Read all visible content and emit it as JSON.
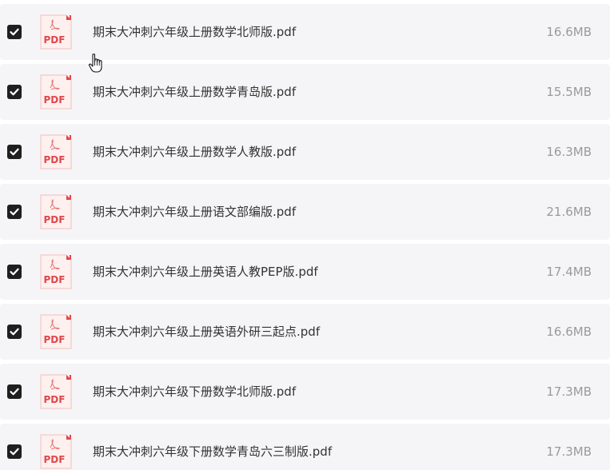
{
  "files": [
    {
      "name": "期末大冲刺六年级上册数学北师版.pdf",
      "size": "16.6MB",
      "checked": true,
      "icon": "pdf-file-icon",
      "icon_label": "PDF"
    },
    {
      "name": "期末大冲刺六年级上册数学青岛版.pdf",
      "size": "15.5MB",
      "checked": true,
      "icon": "pdf-file-icon",
      "icon_label": "PDF"
    },
    {
      "name": "期末大冲刺六年级上册数学人教版.pdf",
      "size": "16.3MB",
      "checked": true,
      "icon": "pdf-file-icon",
      "icon_label": "PDF"
    },
    {
      "name": "期末大冲刺六年级上册语文部编版.pdf",
      "size": "21.6MB",
      "checked": true,
      "icon": "pdf-file-icon",
      "icon_label": "PDF"
    },
    {
      "name": "期末大冲刺六年级上册英语人教PEP版.pdf",
      "size": "17.4MB",
      "checked": true,
      "icon": "pdf-file-icon",
      "icon_label": "PDF"
    },
    {
      "name": "期末大冲刺六年级上册英语外研三起点.pdf",
      "size": "16.6MB",
      "checked": true,
      "icon": "pdf-file-icon",
      "icon_label": "PDF"
    },
    {
      "name": "期末大冲刺六年级下册数学北师版.pdf",
      "size": "17.3MB",
      "checked": true,
      "icon": "pdf-file-icon",
      "icon_label": "PDF"
    },
    {
      "name": "期末大冲刺六年级下册数学青岛六三制版.pdf",
      "size": "17.3MB",
      "checked": true,
      "icon": "pdf-file-icon",
      "icon_label": "PDF"
    }
  ],
  "colors": {
    "row_background": "#f5f5f7",
    "checkbox": "#1f1f1f",
    "pdf_red": "#e0474b",
    "pdf_page": "#fdf0ef",
    "name_text": "#333333",
    "size_text": "#9a9a9a"
  },
  "cursor": "hand-pointer-icon"
}
